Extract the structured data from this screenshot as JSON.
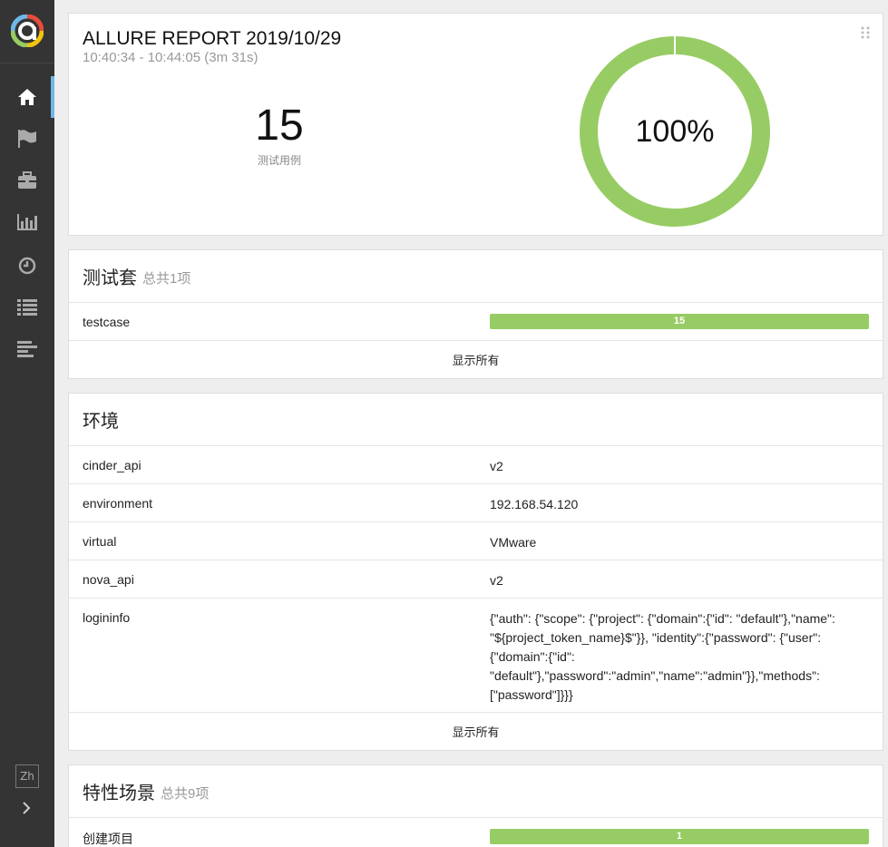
{
  "sidebar": {
    "logo": "allure-logo-icon",
    "items": [
      {
        "icon": "home-icon",
        "active": true
      },
      {
        "icon": "flag-icon",
        "active": false
      },
      {
        "icon": "briefcase-icon",
        "active": false
      },
      {
        "icon": "bar-chart-icon",
        "active": false
      },
      {
        "icon": "clock-icon",
        "active": false
      },
      {
        "icon": "list-icon",
        "active": false
      },
      {
        "icon": "timeline-icon",
        "active": false
      }
    ],
    "lang_label": "Zh",
    "expand_icon": "chevron-right-icon"
  },
  "summary": {
    "title": "ALLURE REPORT 2019/10/29",
    "time": "10:40:34 - 10:44:05 (3m 31s)",
    "count": "15",
    "count_label": "测试用例",
    "percent": "100%",
    "pass_fraction": 1.0,
    "pass_color": "#97cc64"
  },
  "suites": {
    "title": "测试套",
    "subtitle": "总共1项",
    "rows": [
      {
        "name": "testcase",
        "value": "15"
      }
    ],
    "show_all": "显示所有"
  },
  "environment": {
    "title": "环境",
    "rows": [
      {
        "key": "cinder_api",
        "value": "v2"
      },
      {
        "key": "environment",
        "value": "192.168.54.120"
      },
      {
        "key": "virtual",
        "value": "VMware"
      },
      {
        "key": "nova_api",
        "value": "v2"
      },
      {
        "key": "logininfo",
        "value": "{\"auth\": {\"scope\": {\"project\": {\"domain\":{\"id\": \"default\"},\"name\": \"${project_token_name}$\"}}, \"identity\":{\"password\": {\"user\": {\"domain\":{\"id\": \"default\"},\"password\":\"admin\",\"name\":\"admin\"}},\"methods\": [\"password\"]}}}"
      }
    ],
    "show_all": "显示所有"
  },
  "features": {
    "title": "特性场景",
    "subtitle": "总共9项",
    "rows": [
      {
        "name": "创建项目",
        "value": "1"
      }
    ]
  }
}
